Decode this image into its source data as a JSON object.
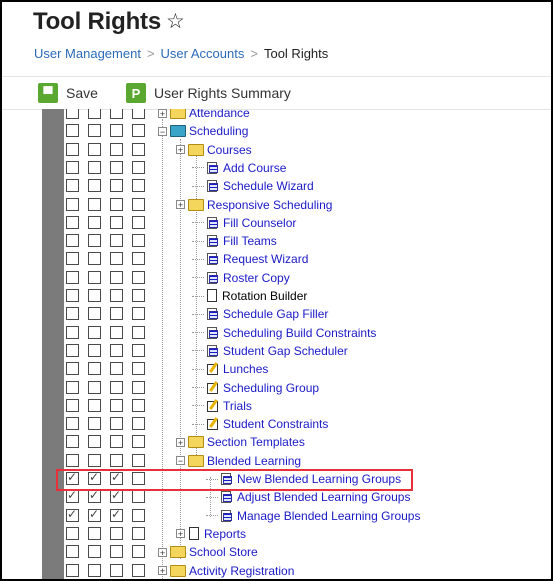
{
  "header": {
    "title": "Tool Rights",
    "star_icon": "☆",
    "breadcrumb": [
      "User Management",
      "User Accounts",
      "Tool Rights"
    ],
    "separator": ">"
  },
  "toolbar": {
    "save_label": "Save",
    "save_icon": "save-icon",
    "summary_label": "User Rights Summary",
    "summary_icon": "p-icon"
  },
  "colors": {
    "accent_green": "#5aa82f",
    "link_blue": "#1a1ac8",
    "highlight_red": "#e8303a"
  },
  "tree": [
    {
      "label": "Attendance",
      "checks": [
        false,
        false,
        false,
        false
      ]
    },
    {
      "label": "Scheduling",
      "checks": [
        false,
        false,
        false,
        false
      ]
    },
    {
      "label": "Courses",
      "checks": [
        false,
        false,
        false,
        false
      ]
    },
    {
      "label": "Add Course",
      "checks": [
        false,
        false,
        false,
        false
      ]
    },
    {
      "label": "Schedule Wizard",
      "checks": [
        false,
        false,
        false,
        false
      ]
    },
    {
      "label": "Responsive Scheduling",
      "checks": [
        false,
        false,
        false,
        false
      ]
    },
    {
      "label": "Fill Counselor",
      "checks": [
        false,
        false,
        false,
        false
      ]
    },
    {
      "label": "Fill Teams",
      "checks": [
        false,
        false,
        false,
        false
      ]
    },
    {
      "label": "Request Wizard",
      "checks": [
        false,
        false,
        false,
        false
      ]
    },
    {
      "label": "Roster Copy",
      "checks": [
        false,
        false,
        false,
        false
      ]
    },
    {
      "label": "Rotation Builder",
      "checks": [
        false,
        false,
        false,
        false
      ]
    },
    {
      "label": "Schedule Gap Filler",
      "checks": [
        false,
        false,
        false,
        false
      ]
    },
    {
      "label": "Scheduling Build Constraints",
      "checks": [
        false,
        false,
        false,
        false
      ]
    },
    {
      "label": "Student Gap Scheduler",
      "checks": [
        false,
        false,
        false,
        false
      ]
    },
    {
      "label": "Lunches",
      "checks": [
        false,
        false,
        false,
        false
      ]
    },
    {
      "label": "Scheduling Group",
      "checks": [
        false,
        false,
        false,
        false
      ]
    },
    {
      "label": "Trials",
      "checks": [
        false,
        false,
        false,
        false
      ]
    },
    {
      "label": "Student Constraints",
      "checks": [
        false,
        false,
        false,
        false
      ]
    },
    {
      "label": "Section Templates",
      "checks": [
        false,
        false,
        false,
        false
      ]
    },
    {
      "label": "Blended Learning",
      "checks": [
        false,
        false,
        false,
        false
      ]
    },
    {
      "label": "New Blended Learning Groups",
      "checks": [
        true,
        true,
        true,
        false
      ]
    },
    {
      "label": "Adjust Blended Learning Groups",
      "checks": [
        true,
        true,
        true,
        false
      ]
    },
    {
      "label": "Manage Blended Learning Groups",
      "checks": [
        true,
        true,
        true,
        false
      ]
    },
    {
      "label": "Reports",
      "checks": [
        false,
        false,
        false,
        false
      ]
    },
    {
      "label": "School Store",
      "checks": [
        false,
        false,
        false,
        false
      ]
    },
    {
      "label": "Activity Registration",
      "checks": [
        false,
        false,
        false,
        false
      ]
    }
  ]
}
